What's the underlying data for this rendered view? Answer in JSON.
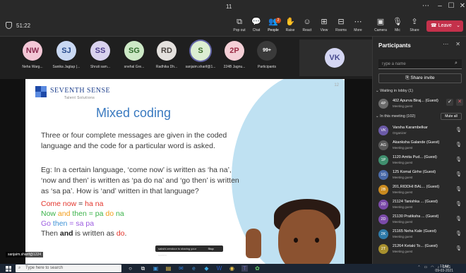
{
  "window": {
    "title": "11",
    "timer": "51:22"
  },
  "toolbar": {
    "buttons": [
      {
        "label": "Pop out",
        "icon": "pop-out-icon"
      },
      {
        "label": "Chat",
        "icon": "chat-icon"
      },
      {
        "label": "People",
        "icon": "people-icon",
        "badge": "2"
      },
      {
        "label": "Raise",
        "icon": "raise-hand-icon"
      },
      {
        "label": "React",
        "icon": "react-icon"
      },
      {
        "label": "View",
        "icon": "view-icon"
      },
      {
        "label": "Rooms",
        "icon": "rooms-icon"
      },
      {
        "label": "More",
        "icon": "more-icon"
      },
      {
        "label": "Camera",
        "icon": "camera-off-icon"
      },
      {
        "label": "Mic",
        "icon": "mic-off-icon"
      },
      {
        "label": "Share",
        "icon": "share-icon"
      }
    ],
    "leave_label": "Leave"
  },
  "strip": {
    "tiles": [
      {
        "initials": "NW",
        "name": "Neha Warg...",
        "bg": "#f3c7d6",
        "fg": "#8a2b4f"
      },
      {
        "initials": "SJ",
        "name": "Sanika Jagtap (...",
        "bg": "#c9d8f2",
        "fg": "#264a8a"
      },
      {
        "initials": "SS",
        "name": "Shruti sam...",
        "bg": "#d9d2ee",
        "fg": "#4a3a8a"
      },
      {
        "initials": "SG",
        "name": "snehal Gre...",
        "bg": "#cde9c6",
        "fg": "#2e6a2a"
      },
      {
        "initials": "RD",
        "name": "Radhika Dh...",
        "bg": "#e4e1de",
        "fg": "#4a4440"
      },
      {
        "initials": "S",
        "name": "sanjaim.sharif@1...",
        "bg": "#dceed2",
        "fg": "#3a6a2a"
      },
      {
        "initials": "2P",
        "name": "224B Jagnu...",
        "bg": "#f4cfd6",
        "fg": "#9a2c44"
      },
      {
        "initials": "99+",
        "name": "Participants",
        "bg": "#3a3a3a",
        "fg": "#ffffff"
      }
    ],
    "highlight": {
      "initials": "VK"
    }
  },
  "slide": {
    "brand": "SEVENTH SENSE",
    "brand_sub": "Talent Solutions",
    "page": "12",
    "title": "Mixed coding",
    "paragraph1": "Three or four complete messages are given in the coded language and the code for a particular word is asked.",
    "paragraph2": "Eg: In a certain language, ‘come now’ is written as ‘ha na’, ‘now and then’ is written as ‘pa do na’ and ‘go then’ is written as ‘sa pa’. How is ‘and’ written in that language?",
    "line1": {
      "a": "Come now",
      "eq": " = ",
      "b": "ha na"
    },
    "line2": {
      "a": "Now",
      "b": " and ",
      "c": "then",
      "eq": " = ",
      "d": "pa",
      "e": " do ",
      "f": "na"
    },
    "line3": {
      "a": "Go",
      "b": " then",
      "eq": " = ",
      "c": "sa pa"
    },
    "line4": {
      "a": "Then ",
      "b": "and",
      "c": " is written as ",
      "d": "do",
      "e": "."
    },
    "share_bar_text": "sakshi.zendoor is sharing your screen",
    "share_bar_stop": "Stop sharing",
    "caption_name": "sanjaim.sharif@1224"
  },
  "panel": {
    "title": "Participants",
    "search_placeholder": "Type a name",
    "share_invite": "Share invite",
    "lobby_header": "Waiting in lobby (1)",
    "lobby": [
      {
        "initials": "4P",
        "name": "402 Apurva Biraj... (Guest)",
        "role": "Meeting guest",
        "bg": "#6b6b6b"
      }
    ],
    "meeting_header": "In this meeting (102)",
    "mute_all": "Mute all",
    "people": [
      {
        "initials": "VK",
        "name": "Varsha Karambelkar",
        "role": "Organizer",
        "bg": "#6b5aa8"
      },
      {
        "initials": "AG",
        "name": "Akanksha Galande (Guest)",
        "role": "Meeting guest",
        "bg": "#5a5a5a"
      },
      {
        "initials": "1P",
        "name": "1120 Amita Pud... (Guest)",
        "role": "Meeting guest",
        "bg": "#3f8f6e"
      },
      {
        "initials": "1G",
        "name": "125 Komal Girhe (Guest)",
        "role": "Meeting guest",
        "bg": "#4a6aa8"
      },
      {
        "initials": "2B",
        "name": "201,RIDDHI BAL... (Guest)",
        "role": "Meeting guest",
        "bg": "#c98a1f"
      },
      {
        "initials": "2D",
        "name": "21124 Tanishka ... (Guest)",
        "role": "Meeting guest",
        "bg": "#7a4aa8"
      },
      {
        "initials": "2D",
        "name": "21130 Pratiksha ... (Guest)",
        "role": "Meeting guest",
        "bg": "#7a4aa8"
      },
      {
        "initials": "2K",
        "name": "21165 Neha Kale (Guest)",
        "role": "Meeting guest",
        "bg": "#2e7aa8"
      },
      {
        "initials": "2T",
        "name": "21264 Ketaki To... (Guest)",
        "role": "Meeting guest",
        "bg": "#a8902e"
      }
    ]
  },
  "taskbar": {
    "search_placeholder": "Type here to search",
    "lang": "ENG",
    "time": "17:44",
    "date": "09-03-2021"
  }
}
